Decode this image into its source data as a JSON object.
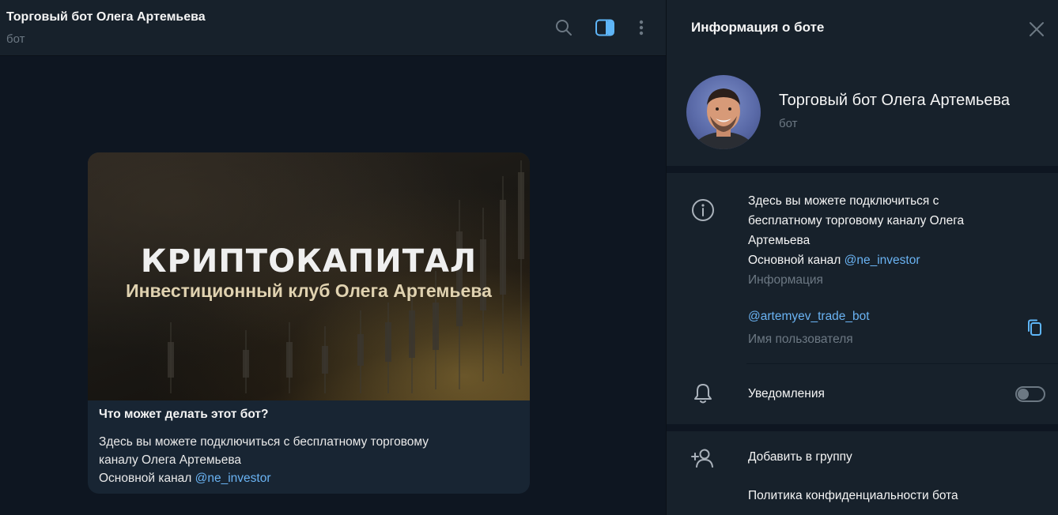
{
  "chat": {
    "title": "Торговый бот Олега Артемьева",
    "subtitle": "бот",
    "card": {
      "banner_title": "КРИПТОКАПИТАЛ",
      "banner_subtitle": "Инвестиционный клуб Олега Артемьева",
      "heading": "Что может делать этот бот?",
      "line1": "Здесь вы можете подключиться с бесплатному торговому",
      "line2": "каналу Олега Артемьева",
      "line3_prefix": "Основной канал ",
      "line3_link": "@ne_investor"
    }
  },
  "header_icons": [
    "search-icon",
    "sidebar-toggle-icon",
    "more-vertical-icon"
  ],
  "panel": {
    "title": "Информация о боте",
    "profile": {
      "name": "Торговый бот Олега Артемьева",
      "subtitle": "бот"
    },
    "info": {
      "line1": "Здесь вы можете подключиться с",
      "line2": "бесплатному торговому каналу Олега",
      "line3": "Артемьева",
      "line4_prefix": "Основной канал ",
      "line4_link": "@ne_investor",
      "caption": "Информация"
    },
    "username": {
      "value": "@artemyev_trade_bot",
      "caption": "Имя пользователя"
    },
    "notifications": {
      "label": "Уведомления",
      "enabled": false
    },
    "actions": {
      "add_to_group": "Добавить в группу",
      "privacy_policy": "Политика конфиденциальности бота"
    }
  },
  "colors": {
    "background": "#0e1621",
    "surface": "#17212b",
    "bubble": "#182533",
    "link": "#6ab3f3",
    "muted": "#6c7883",
    "accent": "#5eb5f7"
  }
}
